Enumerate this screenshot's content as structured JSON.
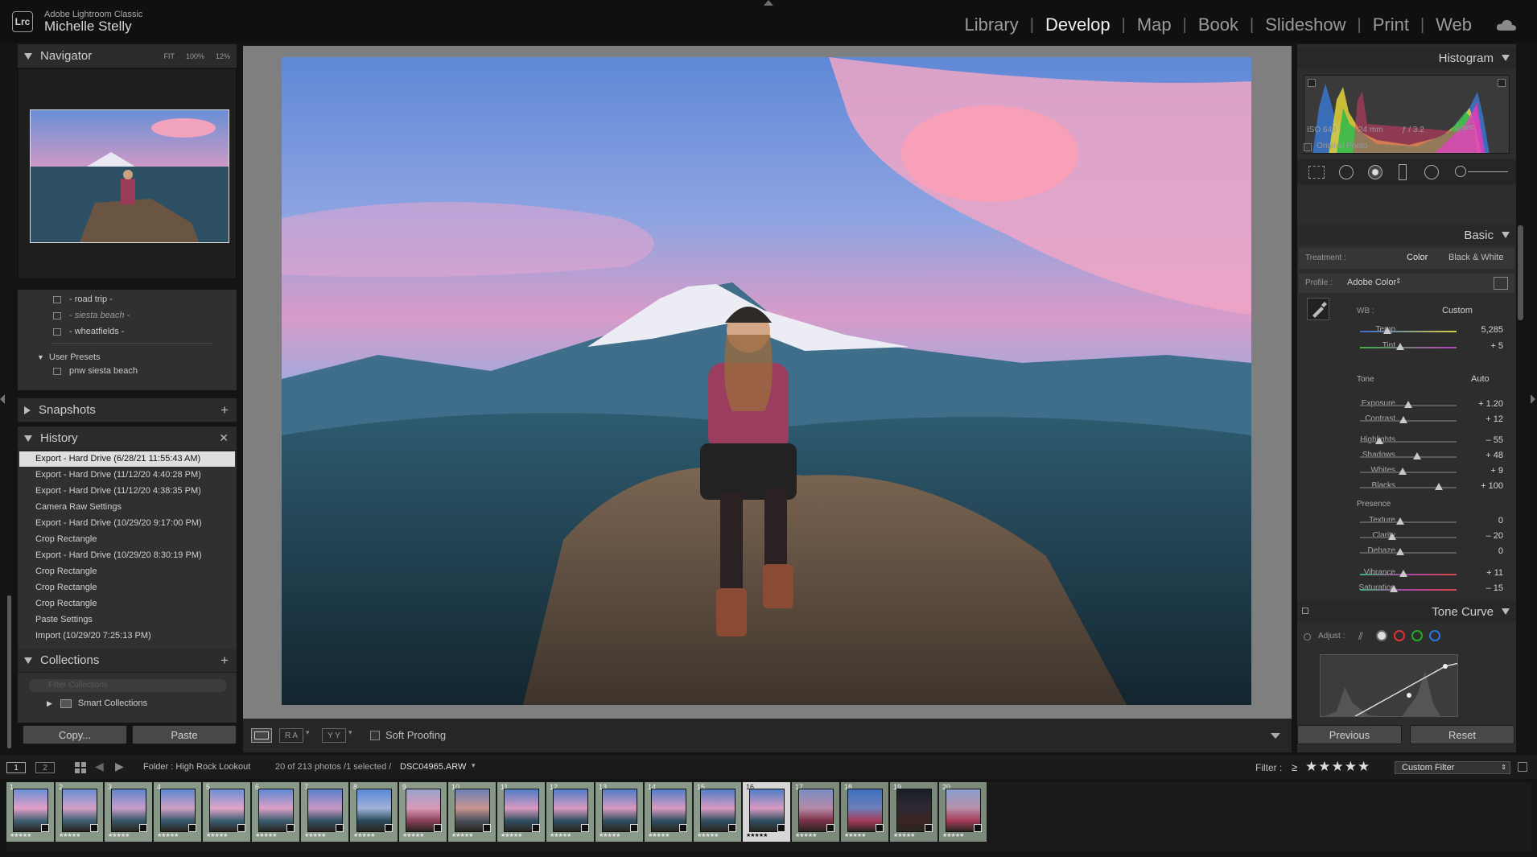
{
  "app": {
    "name": "Adobe Lightroom Classic",
    "user": "Michelle Stelly",
    "logo": "Lrc"
  },
  "modules": [
    {
      "label": "Library",
      "active": false
    },
    {
      "label": "Develop",
      "active": true
    },
    {
      "label": "Map",
      "active": false
    },
    {
      "label": "Book",
      "active": false
    },
    {
      "label": "Slideshow",
      "active": false
    },
    {
      "label": "Print",
      "active": false
    },
    {
      "label": "Web",
      "active": false
    }
  ],
  "navigator": {
    "title": "Navigator",
    "zoom_fit": "FIT",
    "zoom_100": "100%",
    "zoom_12": "12%"
  },
  "presets": {
    "items": [
      "- road trip -",
      "- siesta beach -",
      "- wheatfields -"
    ],
    "group": "User Presets",
    "user_item": "pnw siesta beach"
  },
  "snapshots": {
    "title": "Snapshots"
  },
  "history": {
    "title": "History",
    "items": [
      "Export - Hard Drive (6/28/21 11:55:43 AM)",
      "Export - Hard Drive (11/12/20 4:40:28 PM)",
      "Export - Hard Drive (11/12/20 4:38:35 PM)",
      "Camera Raw Settings",
      "Export - Hard Drive (10/29/20 9:17:00 PM)",
      "Crop Rectangle",
      "Export - Hard Drive (10/29/20 8:30:19 PM)",
      "Crop Rectangle",
      "Crop Rectangle",
      "Crop Rectangle",
      "Paste Settings",
      "Import (10/29/20 7:25:13 PM)"
    ]
  },
  "collections": {
    "title": "Collections",
    "filter_placeholder": "Filter Collections",
    "smart": "Smart Collections"
  },
  "left_buttons": {
    "copy": "Copy...",
    "paste": "Paste"
  },
  "toolbar": {
    "soft_proofing": "Soft Proofing",
    "view_ra": "R A",
    "view_yy": "Y Y"
  },
  "histogram": {
    "title": "Histogram",
    "iso": "ISO 640",
    "focal": "24 mm",
    "aperture": "ƒ / 3.2",
    "shutter_num": "1",
    "shutter_den": "60",
    "shutter_unit": "sec",
    "original": "Original Photo"
  },
  "basic": {
    "title": "Basic",
    "treatment_label": "Treatment :",
    "treatment_color": "Color",
    "treatment_bw": "Black & White",
    "profile_label": "Profile :",
    "profile_value": "Adobe Color",
    "wb_label": "WB :",
    "wb_value": "Custom",
    "tone_label": "Tone",
    "auto": "Auto",
    "presence_label": "Presence",
    "wb_sliders": [
      {
        "name": "Temp",
        "value": "5,285",
        "pos": 0.28
      },
      {
        "name": "Tint",
        "value": "+ 5",
        "pos": 0.42
      }
    ],
    "tone_sliders": [
      {
        "name": "Exposure",
        "value": "+ 1.20",
        "pos": 0.5
      },
      {
        "name": "Contrast",
        "value": "+ 12",
        "pos": 0.45
      }
    ],
    "tone2_sliders": [
      {
        "name": "Highlights",
        "value": "– 55",
        "pos": 0.2
      },
      {
        "name": "Shadows",
        "value": "+ 48",
        "pos": 0.59
      },
      {
        "name": "Whites",
        "value": "+ 9",
        "pos": 0.44
      },
      {
        "name": "Blacks",
        "value": "+ 100",
        "pos": 0.82
      }
    ],
    "presence_sliders": [
      {
        "name": "Texture",
        "value": "0",
        "pos": 0.42
      },
      {
        "name": "Clarity",
        "value": "– 20",
        "pos": 0.33
      },
      {
        "name": "Dehaze",
        "value": "0",
        "pos": 0.42
      }
    ],
    "vib_sliders": [
      {
        "name": "Vibrance",
        "value": "+ 11",
        "pos": 0.45
      },
      {
        "name": "Saturation",
        "value": "– 15",
        "pos": 0.35
      }
    ]
  },
  "tone_curve": {
    "title": "Tone Curve",
    "adjust": "Adjust :"
  },
  "right_buttons": {
    "previous": "Previous",
    "reset": "Reset"
  },
  "filmbar": {
    "view1": "1",
    "view2": "2",
    "folder": "Folder : High Rock Lookout",
    "count": "20 of 213 photos /1 selected /",
    "file": "DSC04965.ARW",
    "filter_label": "Filter :",
    "filter_op": "≥",
    "filter_value": "Custom Filter"
  },
  "filmstrip": {
    "selected": 16,
    "cells": [
      "1",
      "2",
      "3",
      "4",
      "5",
      "6",
      "7",
      "8",
      "9",
      "10",
      "11",
      "12",
      "13",
      "14",
      "15",
      "16",
      "17",
      "18",
      "19",
      "20"
    ],
    "stars": "★★★★★"
  }
}
